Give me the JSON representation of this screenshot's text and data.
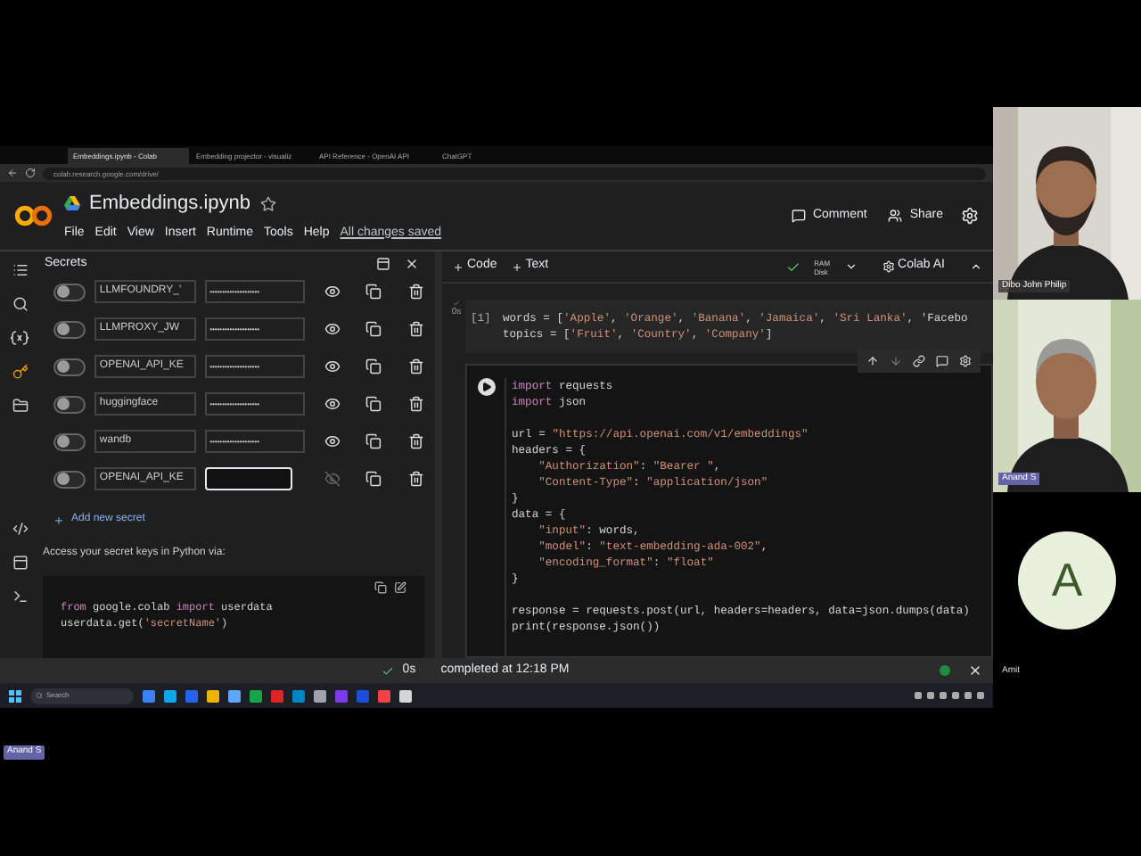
{
  "browser": {
    "tabs": [
      {
        "label": "Embeddings.ipynb - Colab",
        "selected": true
      },
      {
        "label": "Embedding projector - visualiz",
        "selected": false
      },
      {
        "label": "API Reference - OpenAI API",
        "selected": false
      },
      {
        "label": "ChatGPT",
        "selected": false
      }
    ],
    "url": "colab.research.google.com/drive/"
  },
  "notebook": {
    "title": "Embeddings.ipynb",
    "menu": [
      "File",
      "Edit",
      "View",
      "Insert",
      "Runtime",
      "Tools",
      "Help"
    ],
    "save_status": "All changes saved",
    "comment": "Comment",
    "share": "Share"
  },
  "secrets": {
    "title": "Secrets",
    "items": [
      {
        "name": "LLMFOUNDRY_'",
        "value": "••••••••••••••••••••",
        "on": false,
        "editing": false
      },
      {
        "name": "LLMPROXY_JW",
        "value": "••••••••••••••••••••",
        "on": false,
        "editing": false
      },
      {
        "name": "OPENAI_API_KE",
        "value": "••••••••••••••••••••",
        "on": false,
        "editing": false
      },
      {
        "name": "huggingface",
        "value": "••••••••••••••••••••",
        "on": false,
        "editing": false
      },
      {
        "name": "wandb",
        "value": "••••••••••••••••••••",
        "on": false,
        "editing": false
      },
      {
        "name": "OPENAI_API_KE",
        "on": false,
        "editing": true
      }
    ],
    "add": "Add new secret",
    "hint": "Access your secret keys in Python via:",
    "code": [
      "from google.colab import userdata",
      "userdata.get('secretName')"
    ]
  },
  "toolbar": {
    "add_code": "Code",
    "add_text": "Text",
    "ram": "RAM",
    "disk": "Disk",
    "colab_ai": "Colab AI"
  },
  "cells": [
    {
      "index": "[1]",
      "time": "0s",
      "lines": [
        "words = ['Apple', 'Orange', 'Banana', 'Jamaica', 'Sri Lanka', 'Facebo",
        "topics = ['Fruit', 'Country', 'Company']"
      ]
    },
    {
      "blocks": [
        [
          "import requests",
          "import json"
        ],
        [
          "url = \"https://api.openai.com/v1/embeddings\"",
          "headers = {",
          "    \"Authorization\": \"Bearer \",",
          "    \"Content-Type\": \"application/json\"",
          "}",
          "data = {",
          "    \"input\": words,",
          "    \"model\": \"text-embedding-ada-002\",",
          "    \"encoding_format\": \"float\"",
          "}"
        ],
        [
          "response = requests.post(url, headers=headers, data=json.dumps(data)",
          "print(response.json())"
        ]
      ]
    }
  ],
  "status": {
    "time": "0s",
    "message": "completed at 12:18 PM"
  },
  "taskbar": {
    "search": "Search"
  },
  "participants": [
    {
      "name": "Dibo John Philip",
      "kind": "video"
    },
    {
      "name": "Anand S",
      "kind": "video"
    },
    {
      "name": "Amit",
      "kind": "avatar",
      "initial": "A"
    }
  ],
  "presenter": "Anand S"
}
